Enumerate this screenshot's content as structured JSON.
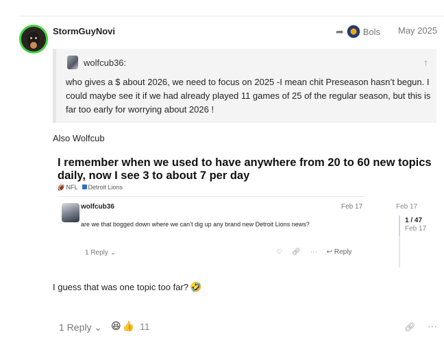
{
  "post": {
    "username": "StormGuyNovi",
    "reply_to_name": "Bols",
    "date": "May 2025",
    "quote": {
      "author": "wolfcub36:",
      "text": "who gives a $ about 2026, we need to focus on 2025 -I mean chit Preseason hasn’t begun. I could maybe see it if we had already played 11 games of 25 of the regular season, but this is far too early for worrying about 2026 !"
    },
    "paragraph1": "Also Wolfcub",
    "onebox": {
      "title": "I remember when we used to have anywhere from 20 to 60 new topics daily, now I see 3 to about 7 per day",
      "category1": "NFL",
      "category2": "Detroit Lions",
      "author": "wolfcub36",
      "date": "Feb 17",
      "excerpt": "are we that bogged down where we can’t dig up any brand new Detroit Lions news?",
      "replies": "1 Reply",
      "reply_label": "Reply",
      "timeline_date": "Feb 17",
      "timeline_count": "1 / 47",
      "timeline_date2": "Feb 17"
    },
    "paragraph2": "I guess that was one topic too far?",
    "footer": {
      "replies": "1 Reply",
      "reaction_count": "11"
    }
  }
}
